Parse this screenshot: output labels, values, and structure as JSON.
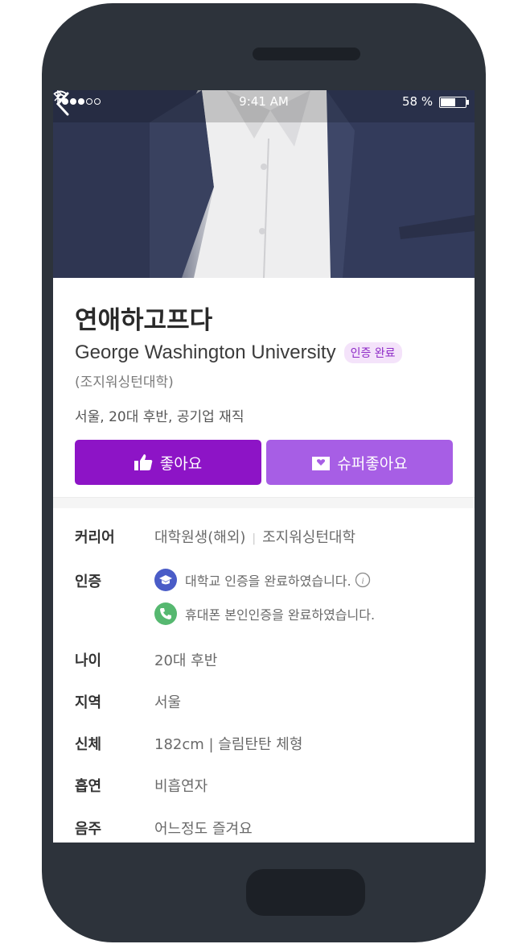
{
  "status": {
    "time": "9:41 AM",
    "battery": "58 %"
  },
  "profile": {
    "nickname": "연애하고프다",
    "school": "George Washington University",
    "badge": "인증 완료",
    "school_kr": "(조지워싱턴대학)",
    "summary": "서울, 20대 후반, 공기업 재직"
  },
  "actions": {
    "like_label": "좋아요",
    "super_like_label": "슈퍼좋아요"
  },
  "info": {
    "career": {
      "label": "커리어",
      "value1": "대학원생(해외)",
      "value2": "조지워싱턴대학"
    },
    "verification": {
      "label": "인증",
      "university": "대학교 인증을 완료하였습니다.",
      "phone": "휴대폰 본인인증을 완료하였습니다."
    },
    "age": {
      "label": "나이",
      "value": "20대 후반"
    },
    "region": {
      "label": "지역",
      "value": "서울"
    },
    "body": {
      "label": "신체",
      "value": "182cm | 슬림탄탄 체형"
    },
    "smoking": {
      "label": "흡연",
      "value": "비흡연자"
    },
    "drinking": {
      "label": "음주",
      "value": "어느정도 즐겨요"
    }
  },
  "colors": {
    "primary": "#8d14c6",
    "secondary": "#a75ee5",
    "badge_bg": "#f4e3fa",
    "grad_cap": "#4a5cc7",
    "phone": "#56b870"
  }
}
